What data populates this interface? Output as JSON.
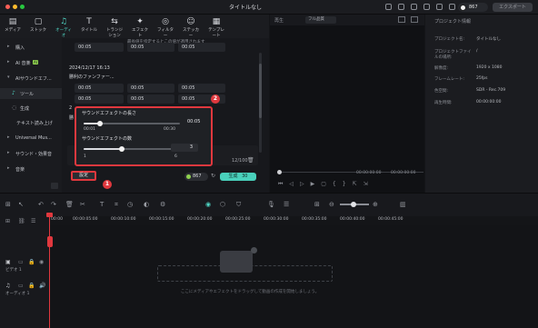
{
  "app": {
    "title": "タイトルなし",
    "credits": "867",
    "export_label": "エクスポート"
  },
  "toolbar": {
    "tabs": [
      {
        "label": "メディア",
        "glyph": "▤",
        "icon": "media-icon"
      },
      {
        "label": "ストック",
        "glyph": "▢",
        "icon": "stock-icon"
      },
      {
        "label": "オーディオ",
        "glyph": "♫",
        "icon": "audio-icon"
      },
      {
        "label": "タイトル",
        "glyph": "T",
        "icon": "title-icon"
      },
      {
        "label": "トランジション",
        "glyph": "⇆",
        "icon": "transition-icon"
      },
      {
        "label": "エフェクト",
        "glyph": "✦",
        "icon": "effect-icon"
      },
      {
        "label": "フィルター",
        "glyph": "◎",
        "icon": "filter-icon"
      },
      {
        "label": "ステッカー",
        "glyph": "☺",
        "icon": "sticker-icon"
      },
      {
        "label": "テンプレート",
        "glyph": "▦",
        "icon": "template-icon"
      }
    ]
  },
  "sidebar": {
    "items": [
      {
        "label": "購入",
        "arrow": "▸"
      },
      {
        "label": "AI 音楽",
        "arrow": "▸",
        "badge": "AI"
      },
      {
        "label": "AIサウンドエフ...",
        "arrow": "▾"
      },
      {
        "label": "ツール",
        "arrow": "",
        "icon": "tool-icon"
      },
      {
        "label": "生成",
        "arrow": "",
        "icon": "generate-icon"
      },
      {
        "label": "テキスト読み上げ",
        "arrow": ""
      },
      {
        "label": "Universal Mus...",
        "arrow": "▸"
      },
      {
        "label": "サウンド・効果音",
        "arrow": "▸"
      },
      {
        "label": "音楽",
        "arrow": "▸"
      }
    ]
  },
  "content": {
    "note": "最長値を指定するとこの値が適用されます",
    "times_row1": [
      "00:05",
      "00:05",
      "00:05"
    ],
    "card_date": "2024/12/17 16:13",
    "card_title": "勝利のファンファー...",
    "times_row2": [
      "00:05",
      "00:05",
      "00:05"
    ],
    "times_row3": [
      "00:05",
      "00:05",
      "00:05"
    ],
    "peek_date": "2",
    "peek_title": "勝",
    "char_count": "12/100"
  },
  "popup": {
    "duration_label": "サウンドエフェクトの長さ",
    "duration_value": "00:05",
    "duration_fraction": 0.17,
    "duration_min": "00:01",
    "duration_max": "00:30",
    "count_label": "サウンドエフェクトの数",
    "count_value": "3",
    "count_fraction": 0.4,
    "count_min": "1",
    "count_max": "6"
  },
  "actions": {
    "settings_label": "設定",
    "credits_pill": "867",
    "generate_label": "生成",
    "generate_cost": "30"
  },
  "callouts": {
    "one": "1",
    "two": "2"
  },
  "player": {
    "label": "再生",
    "quality": "フル品質",
    "time_current": "00:00:00:00",
    "time_total": "00:00:00:00"
  },
  "inspector": {
    "header": "プロジェクト情報",
    "rows": [
      {
        "k": "プロジェクト名:",
        "v": "タイトルなし"
      },
      {
        "k": "プロジェクトファイルの場所:",
        "v": "/"
      },
      {
        "k": "解像度:",
        "v": "1920 x 1080"
      },
      {
        "k": "フレームレート:",
        "v": "25fps"
      },
      {
        "k": "色空間:",
        "v": "SDR - Rec.709"
      },
      {
        "k": "再生時間:",
        "v": "00:00:00:00"
      }
    ]
  },
  "timeline": {
    "ticks": [
      "00:00",
      "00:00:05:00",
      "00:00:10:00",
      "00:00:15:00",
      "00:00:20:00",
      "00:00:25:00",
      "00:00:30:00",
      "00:00:35:00",
      "00:00:40:00",
      "00:00:45:00"
    ],
    "video_track": "ビデオ 1",
    "audio_track": "オーディオ 1",
    "drop_text": "ここにメディアやエフェクトをドラッグして動画の作成を開始しましょう。"
  }
}
